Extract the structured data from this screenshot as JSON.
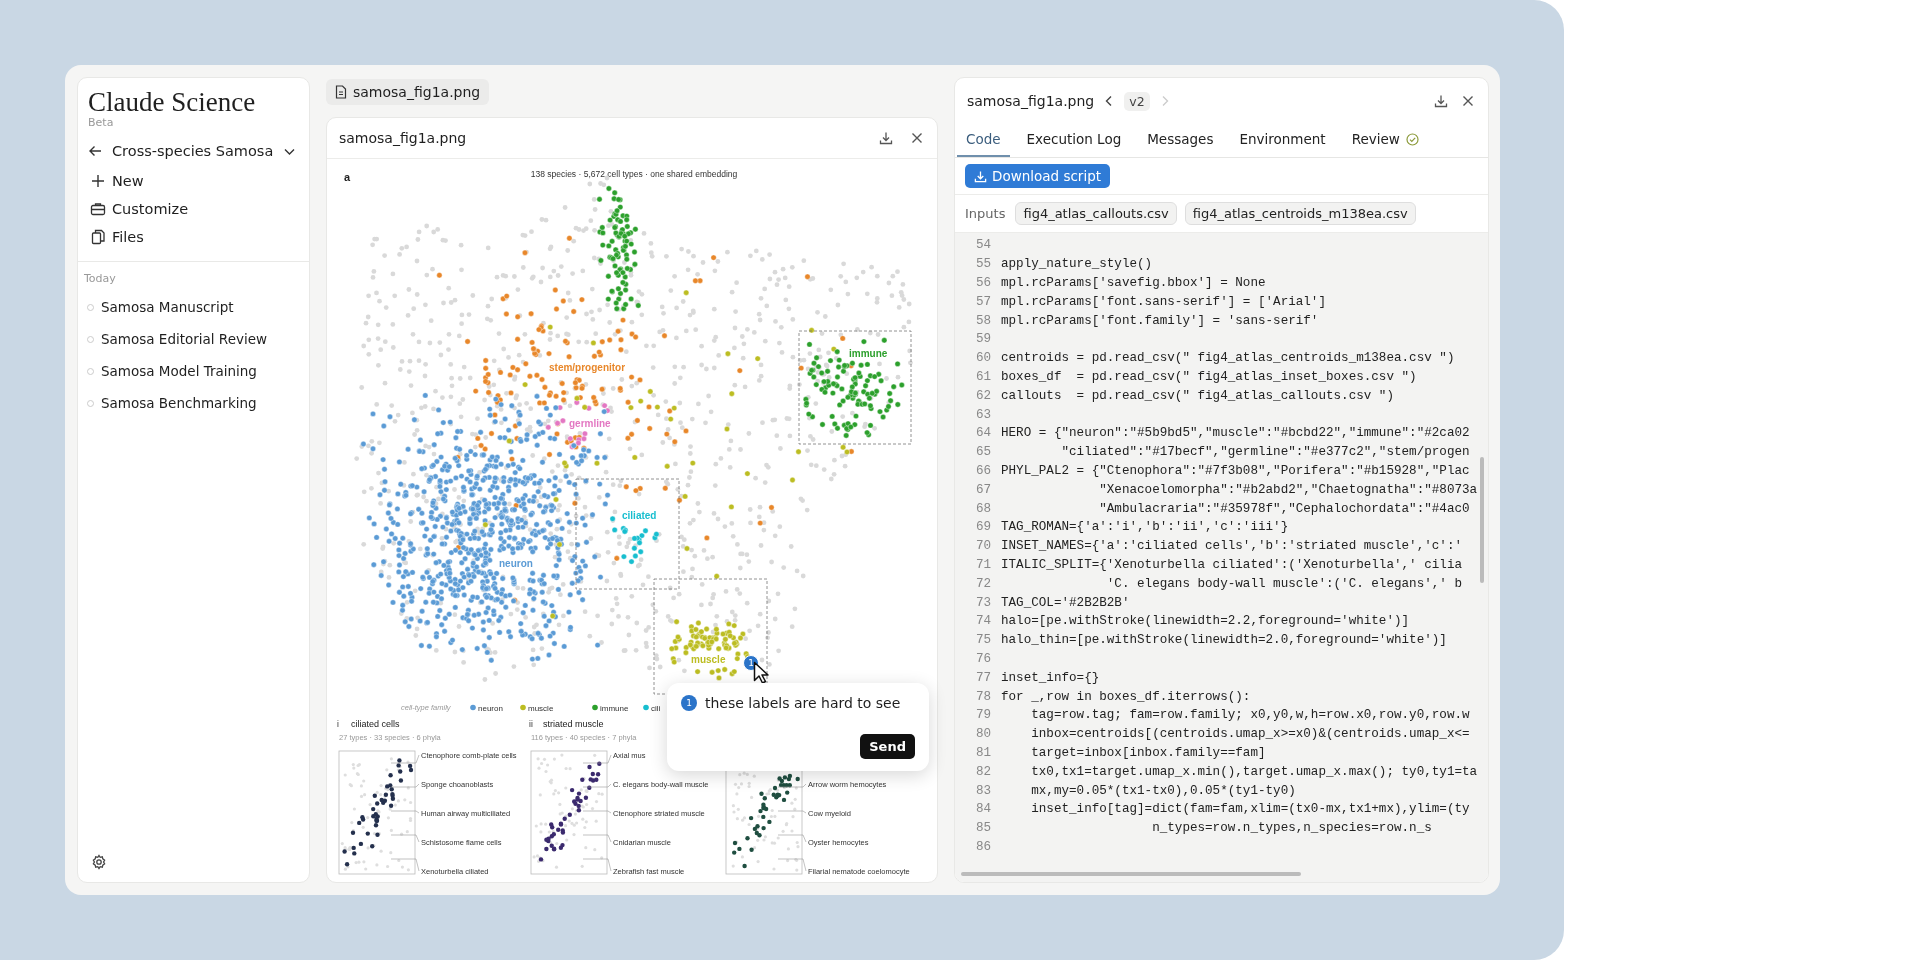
{
  "sidebar": {
    "brand": "Claude Science",
    "badge": "Beta",
    "project": "Cross-species Samosa",
    "actions": [
      {
        "kind": "new",
        "label": "New"
      },
      {
        "kind": "customize",
        "label": "Customize"
      },
      {
        "kind": "files",
        "label": "Files"
      }
    ],
    "section": "Today",
    "chats": [
      "Samosa Manuscript",
      "Samosa Editorial Review",
      "Samosa Model Training",
      "Samosa Benchmarking"
    ]
  },
  "file_tab": {
    "label": "samosa_fig1a.png"
  },
  "viewer": {
    "title": "samosa_fig1a.png",
    "figure": {
      "panel_label": "a",
      "subtitle": "138 species · 5,672 cell types · one shared embedding",
      "cluster_labels": [
        {
          "text": "stem/progenitor",
          "color": "#e8872a"
        },
        {
          "text": "germline",
          "color": "#e377c2"
        },
        {
          "text": "ciliated",
          "color": "#17becf"
        },
        {
          "text": "neuron",
          "color": "#5b9bd5"
        },
        {
          "text": "muscle",
          "color": "#bcbd22"
        },
        {
          "text": "immune",
          "color": "#2ca02c"
        }
      ],
      "legend": {
        "title": "cell-type family",
        "items": [
          {
            "label": "neuron",
            "color": "#5b9bd5"
          },
          {
            "label": "muscle",
            "color": "#bcbd22"
          },
          {
            "label": "immune",
            "color": "#2ca02c"
          },
          {
            "label": "cili",
            "color": "#17becf"
          }
        ]
      },
      "insets": [
        {
          "numeral": "i",
          "title": "ciliated cells",
          "subtitle": "27 types · 33 species · 6 phyla",
          "labels": [
            "Ctenophore comb-plate cells",
            "Sponge choanoblasts",
            "Human airway multiciliated",
            "Schistosome flame cells",
            "Xenoturbella ciliated"
          ]
        },
        {
          "numeral": "ii",
          "title": "striated muscle",
          "subtitle": "116 types · 40 species · 7 phyla",
          "labels": [
            "Axial mus",
            "C. elegans body-wall muscle",
            "Ctenophore striated muscle",
            "Cnidarian muscle",
            "Zebrafish fast muscle"
          ]
        },
        {
          "labels": [
            "Arrow worm hemocytes",
            "Cow myeloid",
            "Oyster hemocytes",
            "Filarial nematode coelomocyte"
          ]
        }
      ]
    },
    "pin": "1",
    "comment": {
      "badge": "1",
      "text": "these labels are hard to see",
      "button": "Send"
    }
  },
  "code_panel": {
    "title": "samosa_fig1a.png",
    "version": "v2",
    "tabs": [
      {
        "label": "Code",
        "selected": true,
        "check": false
      },
      {
        "label": "Execution Log",
        "selected": false,
        "check": false
      },
      {
        "label": "Messages",
        "selected": false,
        "check": false
      },
      {
        "label": "Environment",
        "selected": false,
        "check": false
      },
      {
        "label": "Review",
        "selected": false,
        "check": true
      }
    ],
    "download_button": "Download script",
    "inputs_label": "Inputs",
    "inputs": [
      "fig4_atlas_callouts.csv",
      "fig4_atlas_centroids_m138ea.csv"
    ],
    "lines": [
      {
        "number": "54"
      },
      {
        "number": "55",
        "code": "apply_nature_style()"
      },
      {
        "number": "56",
        "code": "mpl.rcParams['savefig.bbox'] = None"
      },
      {
        "number": "57",
        "code": "mpl.rcParams['font.sans-serif'] = ['Arial']"
      },
      {
        "number": "58",
        "code": "mpl.rcParams['font.family'] = 'sans-serif'"
      },
      {
        "number": "59"
      },
      {
        "number": "60",
        "code": "centroids = pd.read_csv(\" fig4_atlas_centroids_m138ea.csv \")"
      },
      {
        "number": "61",
        "code": "boxes_df  = pd.read_csv(\" fig4_atlas_inset_boxes.csv \")"
      },
      {
        "number": "62",
        "code": "callouts  = pd.read_csv(\" fig4_atlas_callouts.csv \")"
      },
      {
        "number": "63"
      },
      {
        "number": "64",
        "code": "HERO = {\"neuron\":\"#5b9bd5\",\"muscle\":\"#bcbd22\",\"immune\":\"#2ca02"
      },
      {
        "number": "65",
        "code": "        \"ciliated\":\"#17becf\",\"germline\":\"#e377c2\",\"stem/progen"
      },
      {
        "number": "66",
        "code": "PHYL_PAL2 = {\"Ctenophora\":\"#7f3b08\",\"Porifera\":\"#b15928\",\"Plac"
      },
      {
        "number": "67",
        "code": "             \"Xenacoelomorpha\":\"#b2abd2\",\"Chaetognatha\":\"#8073a"
      },
      {
        "number": "68",
        "code": "             \"Ambulacraria\":\"#35978f\",\"Cephalochordata\":\"#4ac0"
      },
      {
        "number": "69",
        "code": "TAG_ROMAN={'a':'i','b':'ii','c':'iii'}"
      },
      {
        "number": "70",
        "code": "INSET_NAMES={'a':'ciliated cells','b':'striated muscle','c':'"
      },
      {
        "number": "71",
        "code": "ITALIC_SPLIT={'Xenoturbella ciliated':('Xenoturbella',' cilia"
      },
      {
        "number": "72",
        "code": "              'C. elegans body-wall muscle':('C. elegans',' b"
      },
      {
        "number": "73",
        "code": "TAG_COL='#2B2B2B'"
      },
      {
        "number": "74",
        "code": "halo=[pe.withStroke(linewidth=2.2,foreground='white')]"
      },
      {
        "number": "75",
        "code": "halo_thin=[pe.withStroke(linewidth=2.0,foreground='white')]"
      },
      {
        "number": "76"
      },
      {
        "number": "77",
        "code": "inset_info={}"
      },
      {
        "number": "78",
        "code": "for _,row in boxes_df.iterrows():"
      },
      {
        "number": "79",
        "code": "    tag=row.tag; fam=row.family; x0,y0,w,h=row.x0,row.y0,row.w"
      },
      {
        "number": "80",
        "code": "    inbox=centroids[(centroids.umap_x>=x0)&(centroids.umap_x<="
      },
      {
        "number": "81",
        "code": "    target=inbox[inbox.family==fam]"
      },
      {
        "number": "82",
        "code": "    tx0,tx1=target.umap_x.min(),target.umap_x.max(); ty0,ty1=ta"
      },
      {
        "number": "83",
        "code": "    mx,my=0.05*(tx1-tx0),0.05*(ty1-ty0)"
      },
      {
        "number": "84",
        "code": "    inset_info[tag]=dict(fam=fam,xlim=(tx0-mx,tx1+mx),ylim=(ty"
      },
      {
        "number": "85",
        "code": "                    n_types=row.n_types,n_species=row.n_s"
      },
      {
        "number": "86"
      }
    ]
  }
}
